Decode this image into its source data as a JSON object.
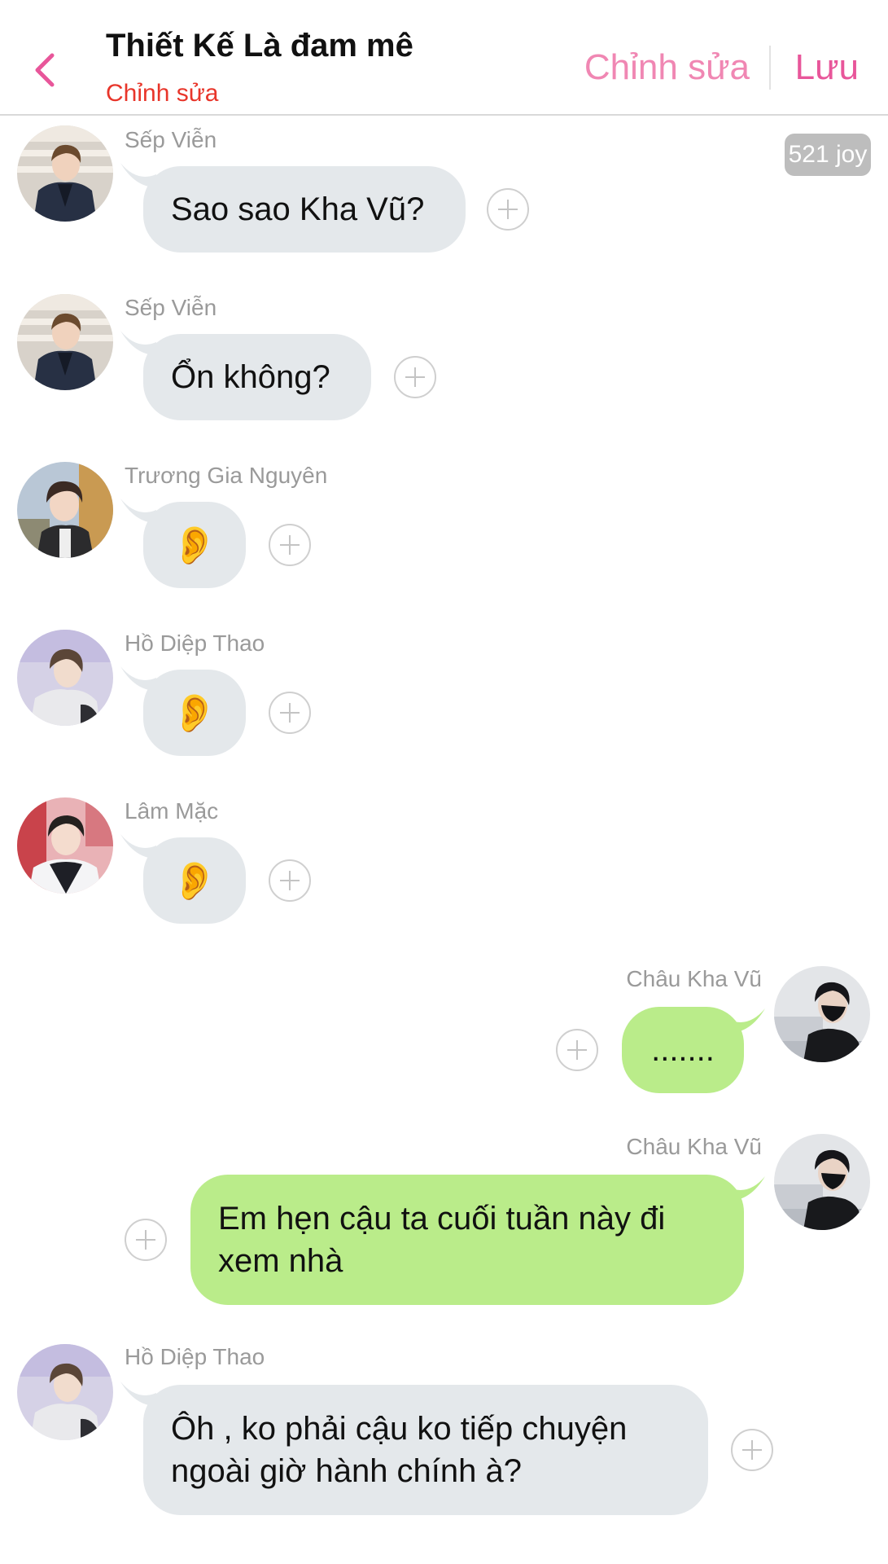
{
  "header": {
    "title": "Thiết Kế Là đam mê",
    "subtitle": "Chỉnh sửa",
    "edit_label": "Chỉnh sửa",
    "save_label": "Lưu",
    "accent_color": "#e8569a"
  },
  "badge": {
    "label": "521 joy"
  },
  "messages": [
    {
      "side": "left",
      "sender": "Sếp Viễn",
      "text": "Sao sao Kha Vũ?",
      "avatar": "avatar-sep-vien"
    },
    {
      "side": "left",
      "sender": "Sếp Viễn",
      "text": "Ổn không?",
      "avatar": "avatar-sep-vien"
    },
    {
      "side": "left",
      "sender": "Trương Gia Nguyên",
      "text": "👂",
      "avatar": "avatar-truong-gia-nguyen"
    },
    {
      "side": "left",
      "sender": "Hồ Diệp Thao",
      "text": "👂",
      "avatar": "avatar-ho-diep-thao"
    },
    {
      "side": "left",
      "sender": "Lâm Mặc",
      "text": "👂",
      "avatar": "avatar-lam-mac"
    },
    {
      "side": "right",
      "sender": "Châu Kha Vũ",
      "text": ".......",
      "avatar": "avatar-chau-kha-vu"
    },
    {
      "side": "right",
      "sender": "Châu Kha Vũ",
      "text": "Em hẹn cậu ta cuối tuần này đi xem nhà",
      "avatar": "avatar-chau-kha-vu"
    },
    {
      "side": "left",
      "sender": "Hồ Diệp Thao",
      "text": "Ôh , ko phải cậu ko tiếp chuyện ngoài giờ hành chính à?",
      "avatar": "avatar-ho-diep-thao"
    }
  ],
  "colors": {
    "bubble_left": "#e4e8eb",
    "bubble_right": "#baec8a",
    "sender_name": "#9a9a9a",
    "subtitle": "#e8352a"
  }
}
